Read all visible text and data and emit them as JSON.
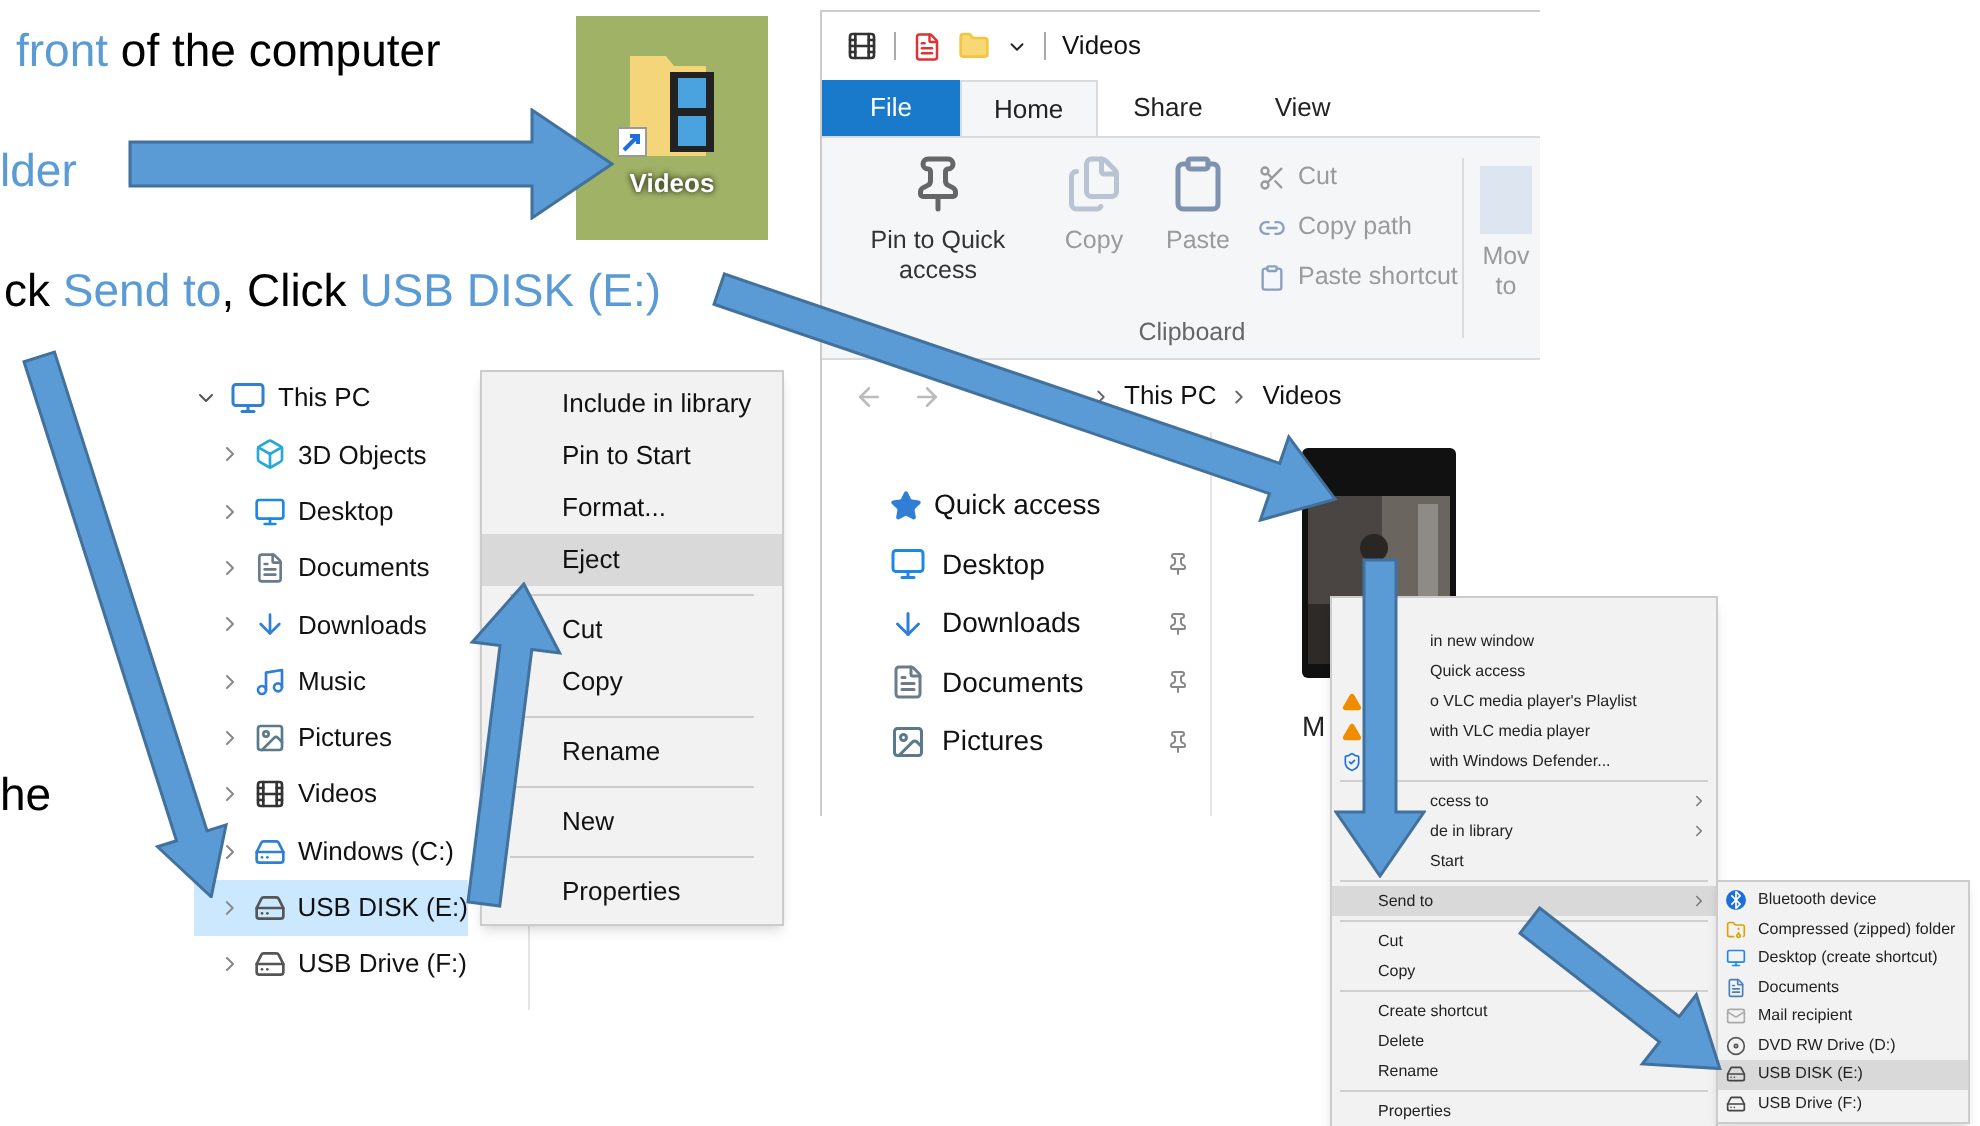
{
  "instructions": [
    {
      "parts": [
        {
          "text": "front",
          "accent": true
        },
        {
          "text": " of the computer",
          "accent": false
        }
      ]
    },
    {
      "parts": [
        {
          "text": "lder",
          "accent": true
        }
      ]
    },
    {
      "parts": [
        {
          "text": "ck ",
          "accent": false
        },
        {
          "text": "Send to",
          "accent": true
        },
        {
          "text": ", Click ",
          "accent": false
        },
        {
          "text": "USB DISK (E:)",
          "accent": true
        }
      ]
    },
    {
      "parts": [
        {
          "text": "he",
          "accent": false
        }
      ]
    }
  ],
  "desktop_shortcut": {
    "label": "Videos"
  },
  "explorer": {
    "title": "Videos",
    "tabs": [
      {
        "label": "File",
        "kind": "file",
        "selected": false
      },
      {
        "label": "Home",
        "kind": "tab",
        "selected": true
      },
      {
        "label": "Share",
        "kind": "tab",
        "selected": false
      },
      {
        "label": "View",
        "kind": "tab",
        "selected": false
      }
    ],
    "ribbon": {
      "large_buttons": [
        {
          "label": "Pin to Quick access",
          "disabled": false
        },
        {
          "label": "Copy",
          "disabled": true
        },
        {
          "label": "Paste",
          "disabled": true
        }
      ],
      "small_buttons": [
        {
          "label": "Cut",
          "disabled": true
        },
        {
          "label": "Copy path",
          "disabled": true
        },
        {
          "label": "Paste shortcut",
          "disabled": true
        }
      ],
      "group_label": "Clipboard",
      "cut_off_button": [
        "Mov",
        "to"
      ]
    },
    "address": [
      "This PC",
      "Videos"
    ],
    "navigation": [
      {
        "label": "Quick access",
        "kind": "header",
        "pinned": false
      },
      {
        "label": "Desktop",
        "kind": "item",
        "pinned": true
      },
      {
        "label": "Downloads",
        "kind": "item",
        "pinned": true
      },
      {
        "label": "Documents",
        "kind": "item",
        "pinned": true
      },
      {
        "label": "Pictures",
        "kind": "item",
        "pinned": true
      }
    ],
    "file_name": "M"
  },
  "tree": [
    {
      "label": "This PC",
      "expanded": true,
      "selected": false,
      "children": [
        {
          "label": "3D Objects",
          "expanded": false,
          "selected": false
        },
        {
          "label": "Desktop",
          "expanded": false,
          "selected": false
        },
        {
          "label": "Documents",
          "expanded": false,
          "selected": false
        },
        {
          "label": "Downloads",
          "expanded": false,
          "selected": false
        },
        {
          "label": "Music",
          "expanded": false,
          "selected": false
        },
        {
          "label": "Pictures",
          "expanded": false,
          "selected": false
        },
        {
          "label": "Videos",
          "expanded": false,
          "selected": false
        },
        {
          "label": "Windows (C:)",
          "expanded": false,
          "selected": false
        },
        {
          "label": "USB DISK (E:)",
          "expanded": false,
          "selected": true
        },
        {
          "label": "USB Drive (F:)",
          "expanded": false,
          "selected": false
        }
      ]
    }
  ],
  "drive_menu": [
    {
      "kind": "item",
      "label": "Include in library",
      "highlighted": false
    },
    {
      "kind": "item",
      "label": "Pin to Start",
      "highlighted": false
    },
    {
      "kind": "item",
      "label": "Format...",
      "highlighted": false
    },
    {
      "kind": "item",
      "label": "Eject",
      "highlighted": true
    },
    {
      "kind": "separator"
    },
    {
      "kind": "item",
      "label": "Cut",
      "highlighted": false
    },
    {
      "kind": "item",
      "label": "Copy",
      "highlighted": false
    },
    {
      "kind": "separator"
    },
    {
      "kind": "item",
      "label": "Rename",
      "highlighted": false
    },
    {
      "kind": "separator"
    },
    {
      "kind": "item",
      "label": "New",
      "highlighted": false
    },
    {
      "kind": "separator"
    },
    {
      "kind": "item",
      "label": "Properties",
      "highlighted": false
    }
  ],
  "file_menu": [
    {
      "kind": "fragment",
      "label": "in new window",
      "highlighted": false,
      "submenu": false
    },
    {
      "kind": "fragment",
      "label": "Quick access",
      "highlighted": false,
      "submenu": false
    },
    {
      "kind": "fragment",
      "label": "o VLC media player's Playlist",
      "highlighted": false,
      "submenu": false
    },
    {
      "kind": "fragment",
      "label": "with VLC media player",
      "highlighted": false,
      "submenu": false
    },
    {
      "kind": "fragment",
      "label": "with Windows Defender...",
      "highlighted": false,
      "submenu": false
    },
    {
      "kind": "separator"
    },
    {
      "kind": "fragment",
      "label": "ccess to",
      "highlighted": false,
      "submenu": true
    },
    {
      "kind": "fragment",
      "label": "de in library",
      "highlighted": false,
      "submenu": true
    },
    {
      "kind": "fragment",
      "label": "Start",
      "highlighted": false,
      "submenu": false
    },
    {
      "kind": "separator"
    },
    {
      "kind": "item",
      "label": "Send to",
      "highlighted": true,
      "submenu": true
    },
    {
      "kind": "separator"
    },
    {
      "kind": "item",
      "label": "Cut",
      "highlighted": false,
      "submenu": false
    },
    {
      "kind": "item",
      "label": "Copy",
      "highlighted": false,
      "submenu": false
    },
    {
      "kind": "separator"
    },
    {
      "kind": "item",
      "label": "Create shortcut",
      "highlighted": false,
      "submenu": false
    },
    {
      "kind": "item",
      "label": "Delete",
      "highlighted": false,
      "submenu": false
    },
    {
      "kind": "item",
      "label": "Rename",
      "highlighted": false,
      "submenu": false
    },
    {
      "kind": "separator"
    },
    {
      "kind": "item",
      "label": "Properties",
      "highlighted": false,
      "submenu": false
    }
  ],
  "send_to_menu": [
    {
      "label": "Bluetooth device",
      "highlighted": false
    },
    {
      "label": "Compressed (zipped) folder",
      "highlighted": false
    },
    {
      "label": "Desktop (create shortcut)",
      "highlighted": false
    },
    {
      "label": "Documents",
      "highlighted": false
    },
    {
      "label": "Mail recipient",
      "highlighted": false
    },
    {
      "label": "DVD RW Drive (D:)",
      "highlighted": false
    },
    {
      "label": "USB DISK (E:)",
      "highlighted": true
    },
    {
      "label": "USB Drive (F:)",
      "highlighted": false
    }
  ]
}
